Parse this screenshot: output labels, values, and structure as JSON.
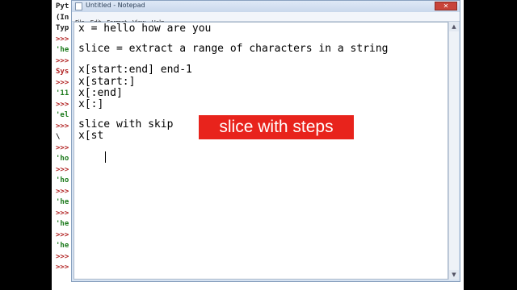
{
  "colors": {
    "caption_bg": "#e8231c",
    "shell_prompt": "#b01e1e",
    "shell_string": "#1c7a1c"
  },
  "shell": {
    "lines": [
      {
        "text": "Pyt",
        "color": "black"
      },
      {
        "text": "(In",
        "color": "black"
      },
      {
        "text": "Typ",
        "color": "black"
      },
      {
        "text": ">>>",
        "color": "red"
      },
      {
        "text": "'he",
        "color": "green"
      },
      {
        "text": ">>>",
        "color": "red"
      },
      {
        "text": "Sys",
        "color": "red"
      },
      {
        "text": ">>>",
        "color": "red"
      },
      {
        "text": "'11",
        "color": "green"
      },
      {
        "text": ">>>",
        "color": "red"
      },
      {
        "text": "'el",
        "color": "green"
      },
      {
        "text": ">>>",
        "color": "red"
      },
      {
        "text": "\\",
        "color": "black"
      },
      {
        "text": ">>>",
        "color": "red"
      },
      {
        "text": "'ho",
        "color": "green"
      },
      {
        "text": ">>>",
        "color": "red"
      },
      {
        "text": "'ho",
        "color": "green"
      },
      {
        "text": ">>>",
        "color": "red"
      },
      {
        "text": "'he",
        "color": "green"
      },
      {
        "text": ">>>",
        "color": "red"
      },
      {
        "text": "'he",
        "color": "green"
      },
      {
        "text": ">>>",
        "color": "red"
      },
      {
        "text": "'he",
        "color": "green"
      },
      {
        "text": ">>>",
        "color": "red"
      },
      {
        "text": ">>>",
        "color": "red"
      }
    ]
  },
  "notepad": {
    "title": "Untitled - Notepad",
    "close_label": "✕",
    "menu": [
      "File",
      "Edit",
      "Format",
      "View",
      "Help"
    ],
    "editor_lines": [
      "x = hello how are you",
      "",
      "slice = extract a range of characters in a string",
      "",
      "x[start:end] end-1",
      "x[start:]",
      "x[:end]",
      "x[:]",
      "",
      "slice with skip",
      "x[st"
    ]
  },
  "caption": {
    "text": "slice with steps"
  }
}
